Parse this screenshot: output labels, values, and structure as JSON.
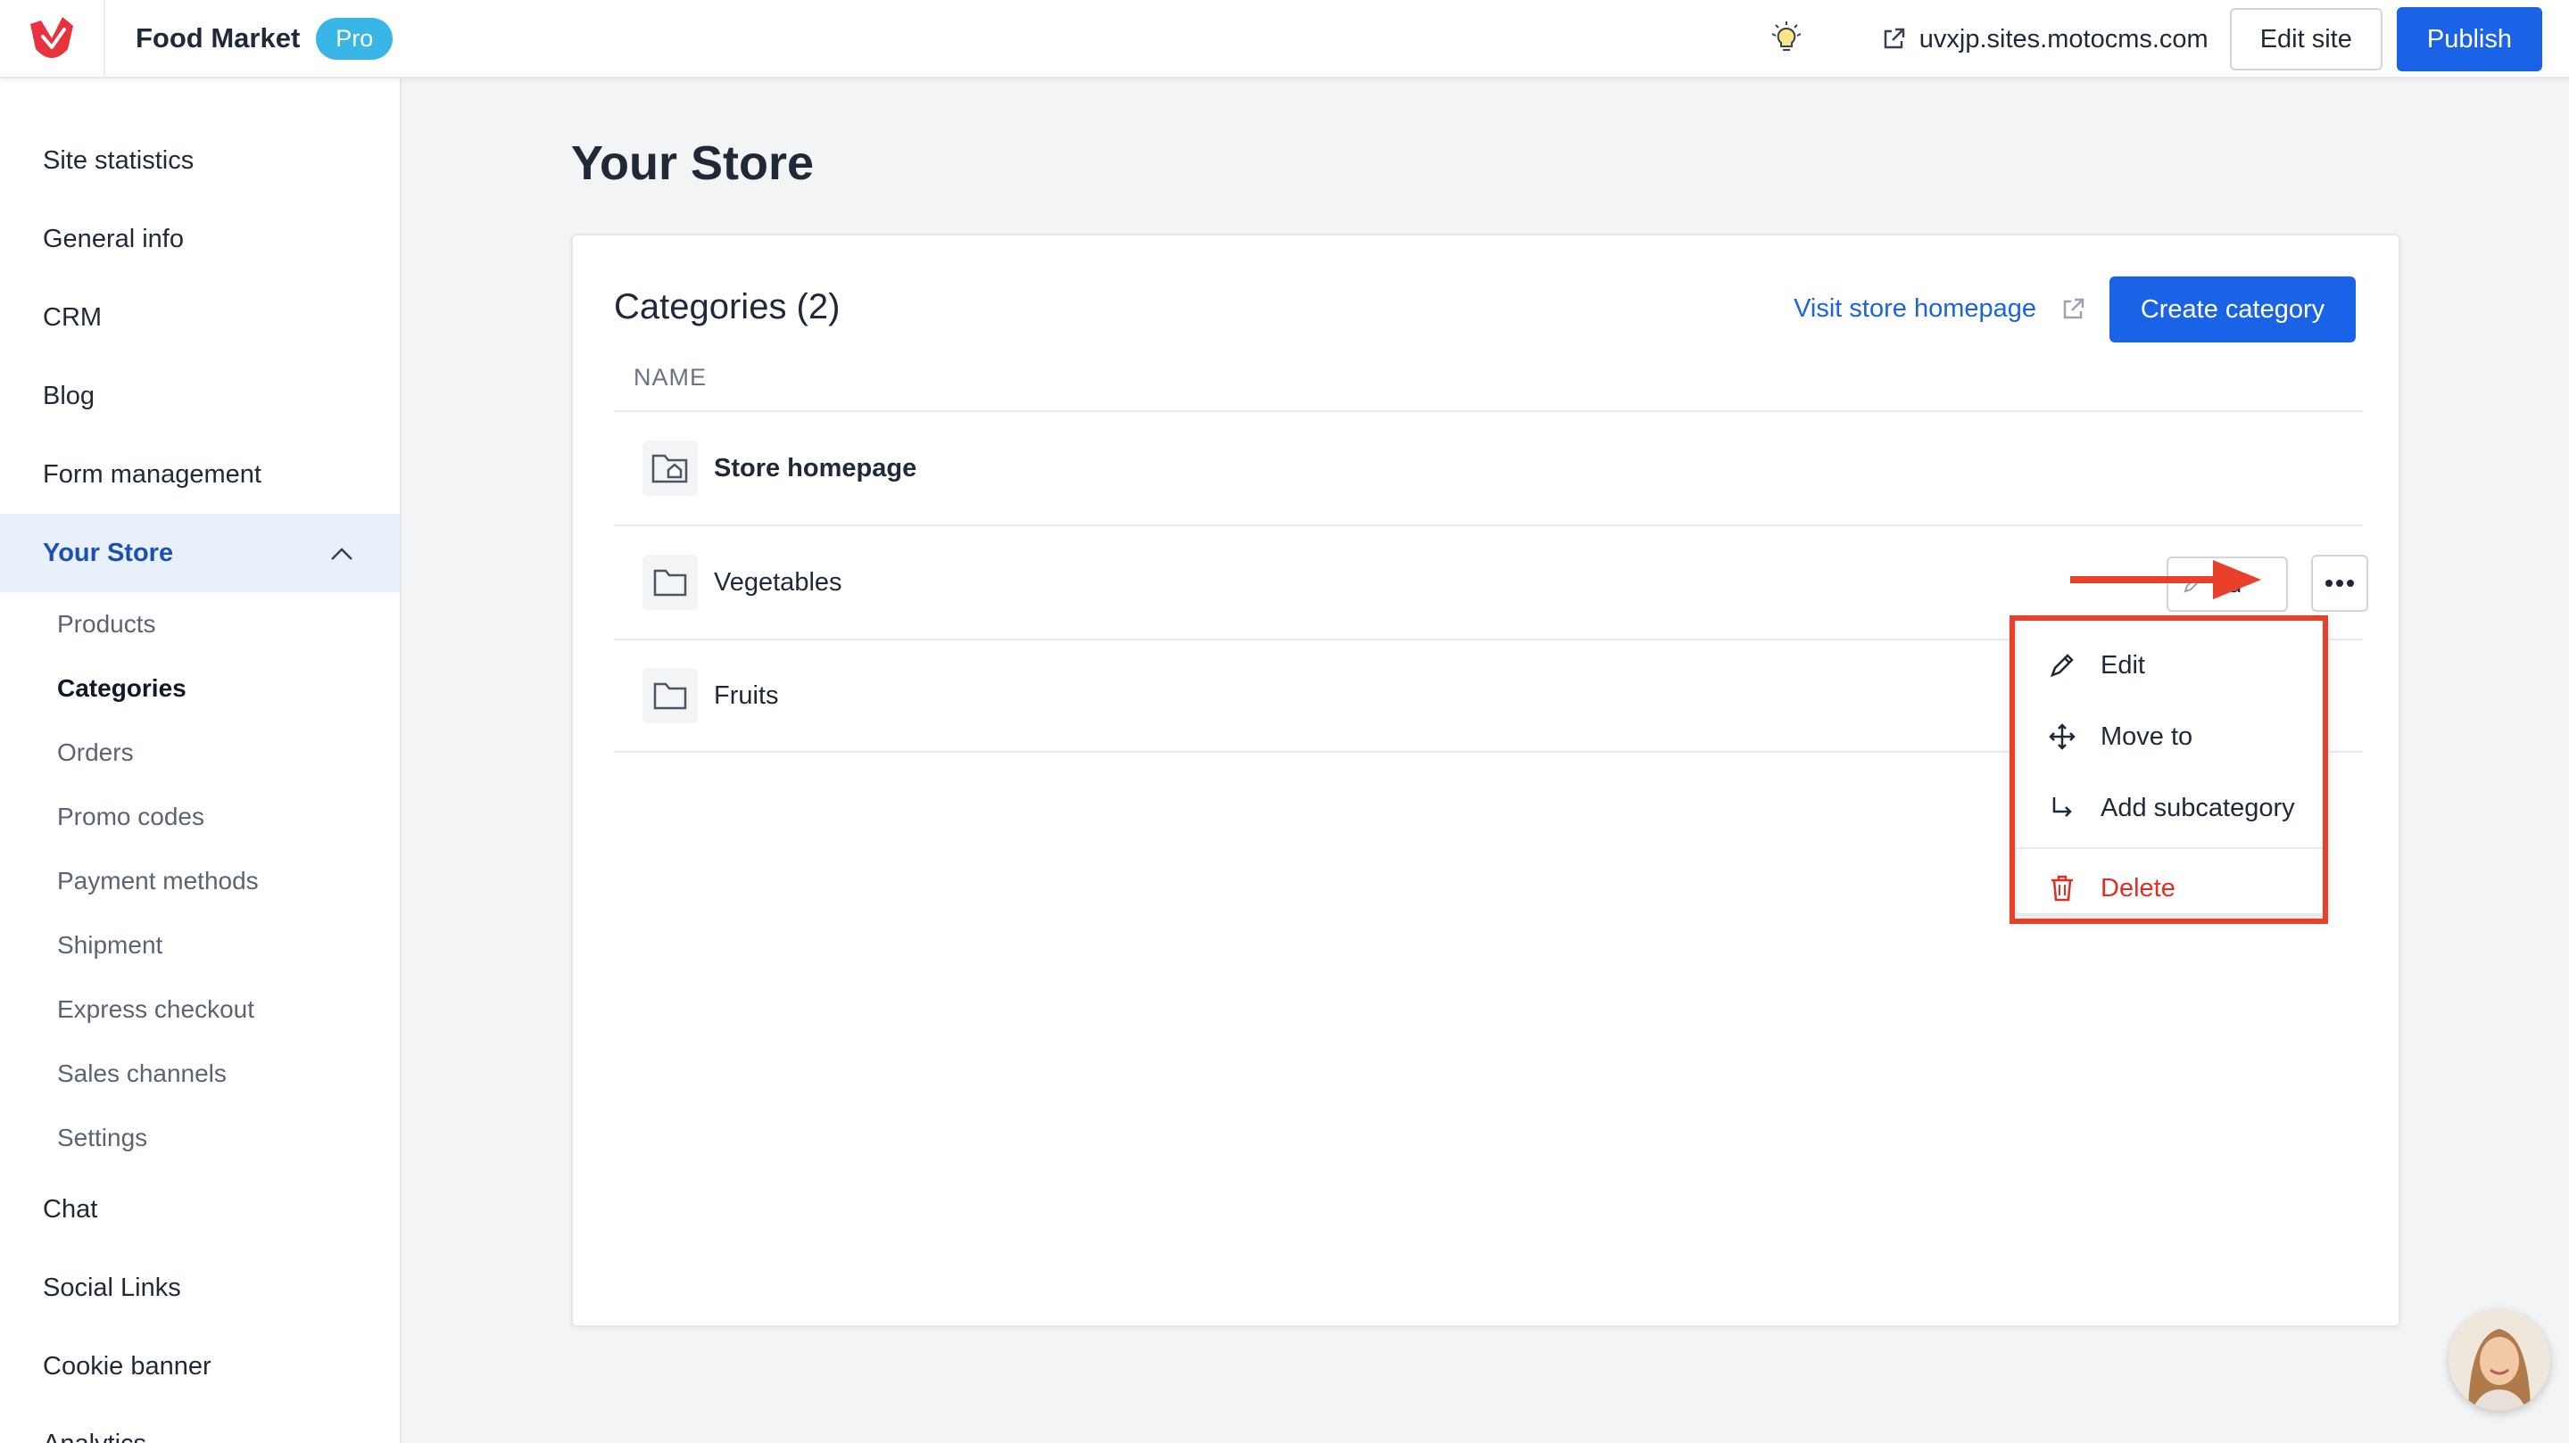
{
  "topbar": {
    "app_name": "Food Market",
    "plan_badge": "Pro",
    "site_url": "uvxjp.sites.motocms.com",
    "edit_site_label": "Edit site",
    "publish_label": "Publish"
  },
  "sidebar": {
    "items": [
      {
        "label": "Site statistics"
      },
      {
        "label": "General info"
      },
      {
        "label": "CRM"
      },
      {
        "label": "Blog"
      },
      {
        "label": "Form management"
      },
      {
        "label": "Your Store"
      }
    ],
    "store_subitems": [
      {
        "label": "Products"
      },
      {
        "label": "Categories"
      },
      {
        "label": "Orders"
      },
      {
        "label": "Promo codes"
      },
      {
        "label": "Payment methods"
      },
      {
        "label": "Shipment"
      },
      {
        "label": "Express checkout"
      },
      {
        "label": "Sales channels"
      },
      {
        "label": "Settings"
      }
    ],
    "bottom_items": [
      {
        "label": "Chat"
      },
      {
        "label": "Social Links"
      },
      {
        "label": "Cookie banner"
      },
      {
        "label": "Analytics"
      }
    ]
  },
  "main": {
    "page_title": "Your Store",
    "card_title": "Categories (2)",
    "visit_link": "Visit store homepage",
    "create_button": "Create category",
    "column_header": "NAME",
    "rows": [
      {
        "label": "Store homepage"
      },
      {
        "label": "Vegetables",
        "edit_button": "Ed"
      },
      {
        "label": "Fruits"
      }
    ]
  },
  "menu": {
    "items": [
      {
        "label": "Edit",
        "icon": "pencil-icon"
      },
      {
        "label": "Move to",
        "icon": "move-icon"
      },
      {
        "label": "Add subcategory",
        "icon": "subcategory-arrow-icon"
      },
      {
        "label": "Delete",
        "icon": "trash-icon"
      }
    ]
  },
  "colors": {
    "accent": "#1a63e6",
    "brand_red": "#e8323c",
    "annotation_red": "#e8402a",
    "pro_badge": "#38b6e6"
  }
}
